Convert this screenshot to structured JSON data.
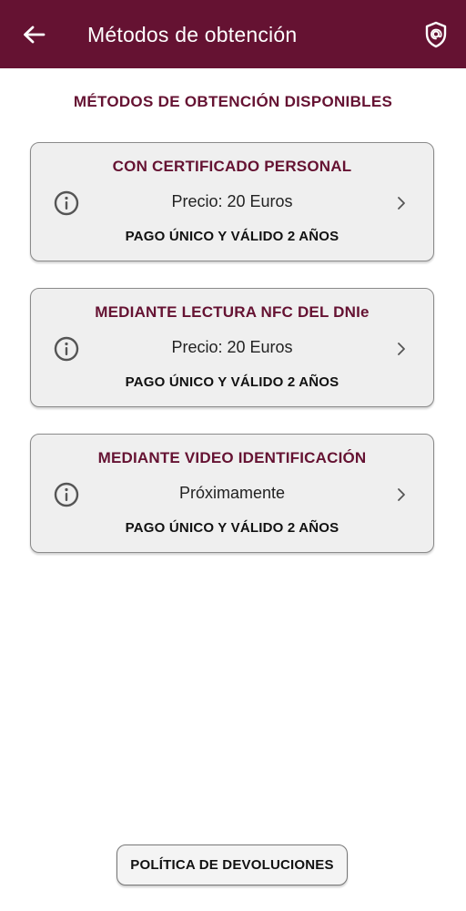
{
  "app_bar": {
    "title": "Métodos de obtención",
    "back_icon": "arrow-left-icon",
    "shield_icon": "shield-at-icon",
    "background_color": "#651232"
  },
  "section": {
    "title": "MÉTODOS DE OBTENCIÓN DISPONIBLES"
  },
  "methods": [
    {
      "title": "CON CERTIFICADO PERSONAL",
      "price": "Precio: 20 Euros",
      "note": "PAGO ÚNICO Y VÁLIDO 2 AÑOS"
    },
    {
      "title": "MEDIANTE LECTURA NFC DEL DNIe",
      "price": "Precio: 20 Euros",
      "note": "PAGO ÚNICO Y VÁLIDO 2 AÑOS"
    },
    {
      "title": "MEDIANTE VIDEO IDENTIFICACIÓN",
      "price": "Próximamente",
      "note": "PAGO ÚNICO Y VÁLIDO 2 AÑOS"
    }
  ],
  "footer": {
    "refund_button_label": "POLÍTICA DE DEVOLUCIONES"
  },
  "colors": {
    "accent": "#651232",
    "card_background": "#efefef"
  }
}
